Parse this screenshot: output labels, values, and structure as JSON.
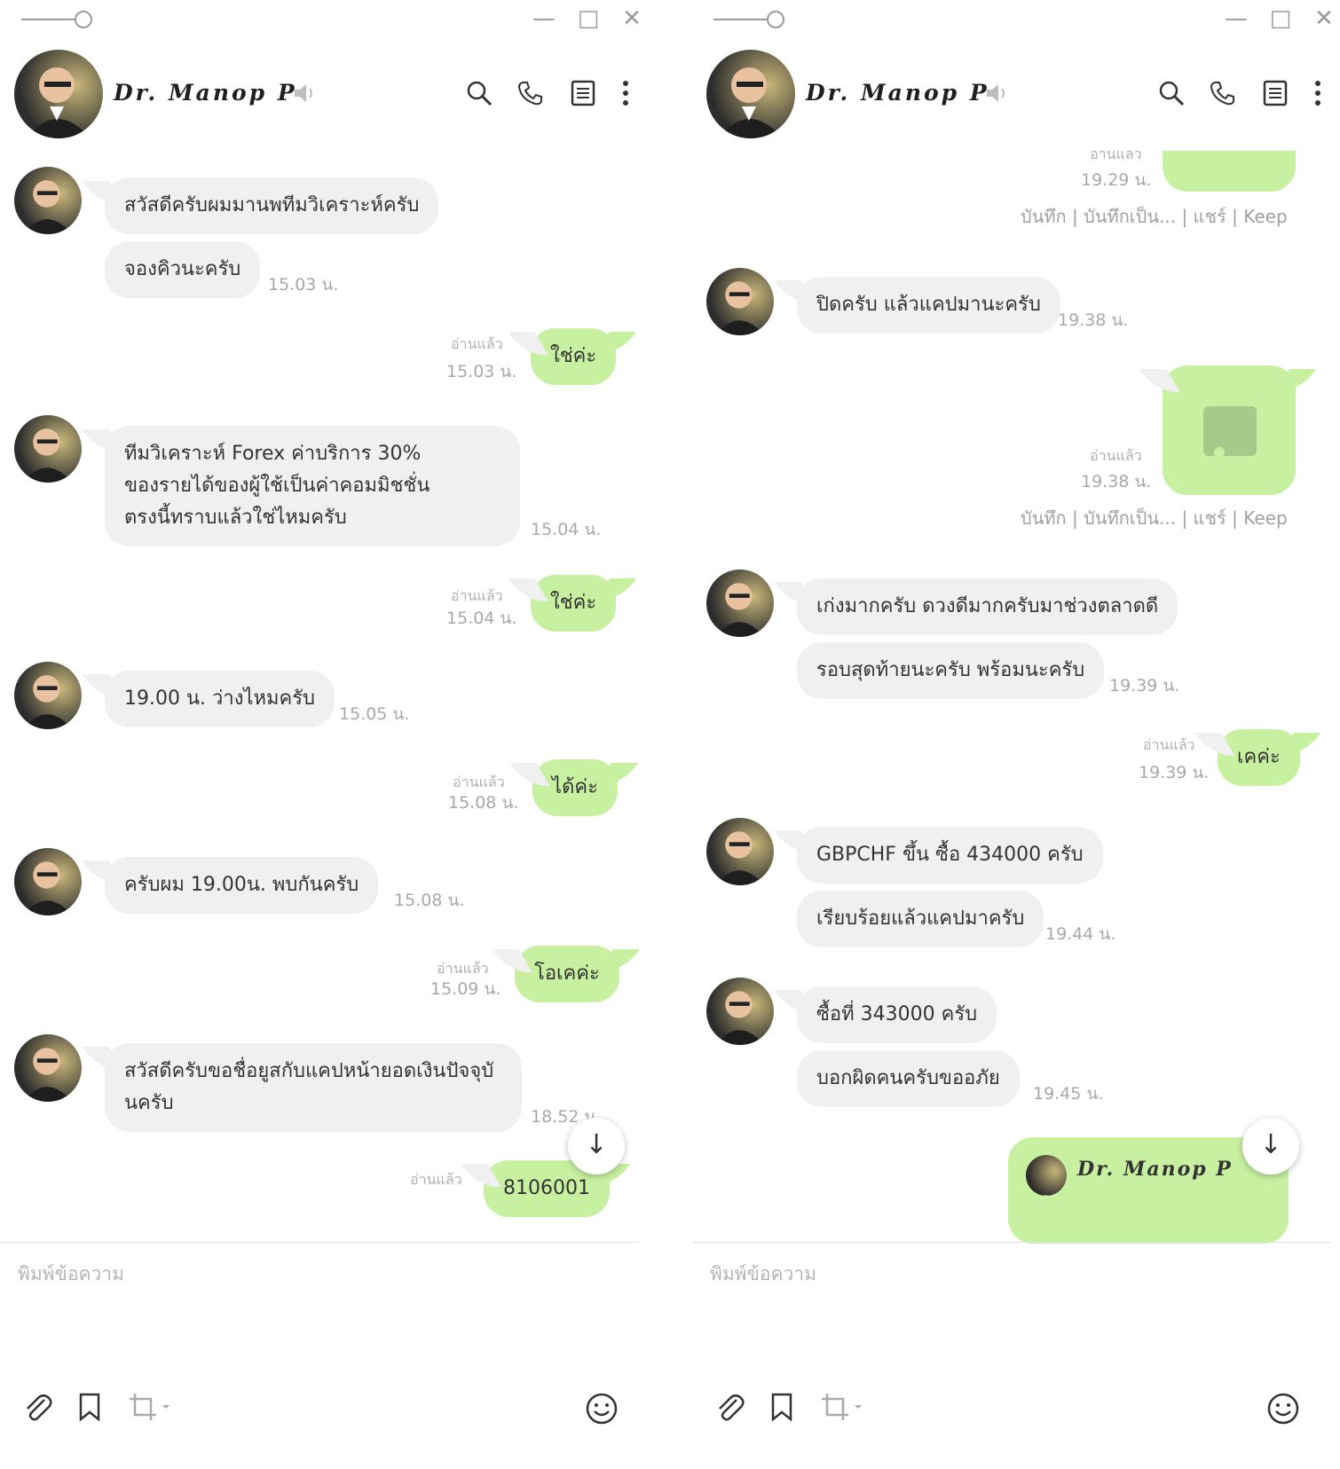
{
  "contact_name": "Dr. Manop P",
  "input_placeholder": "พิมพ์ข้อความ",
  "read_label": "อ่านแล้ว",
  "left": {
    "messages": [
      {
        "text": "สวัสดีครับผมมานพทีมวิเคราะห์ครับ"
      },
      {
        "text": "จองคิวนะครับ",
        "time": "15.03 น."
      },
      {
        "text": "ใช่ค่ะ",
        "time": "15.03 น."
      },
      {
        "text": "ทีมวิเคราะห์ Forex  ค่าบริการ 30%\nของรายได้ของผู้ใช้เป็นค่าคอมมิชชั่น\nตรงนี้ทราบแล้วใช่ไหมครับ",
        "time": "15.04 น."
      },
      {
        "text": "ใช่ค่ะ",
        "time": "15.04 น."
      },
      {
        "text": "19.00 น. ว่างไหมครับ",
        "time": "15.05 น."
      },
      {
        "text": "ได้ค่ะ",
        "time": "15.08 น."
      },
      {
        "text": "ครับผม 19.00น. พบกันครับ",
        "time": "15.08 น."
      },
      {
        "text": "โอเคค่ะ",
        "time": "15.09 น."
      },
      {
        "text": "สวัสดีครับขอชื่อยูสกับแคปหน้ายอดเงินปัจจุบั\nนครับ",
        "time": "18.52 น."
      },
      {
        "text": "8106001"
      }
    ]
  },
  "right": {
    "partial_read": "อ่านแล้ว",
    "messages": [
      {
        "time": "19.29 น."
      },
      {
        "text": "ปิดครับ แล้วแคปมานะครับ",
        "time": "19.38 น."
      },
      {
        "time": "19.38 น."
      },
      {
        "text": "เก่งมากครับ ดวงดีมากครับมาช่วงตลาดดี"
      },
      {
        "text": "รอบสุดท้ายนะครับ พร้อมนะครับ",
        "time": "19.39 น."
      },
      {
        "text": "เคค่ะ",
        "time": "19.39 น."
      },
      {
        "text": "GBPCHF ขึ้น ซื้อ 434000 ครับ"
      },
      {
        "text": "เรียบร้อยแล้วแคปมาครับ",
        "time": "19.44 น."
      },
      {
        "text": "ซื้อที่ 343000 ครับ"
      },
      {
        "text": "บอกผิดคนครับขออภัย",
        "time": "19.45 น."
      },
      {
        "text": "Dr. Manop P"
      }
    ],
    "actions": {
      "save": "บันทึก",
      "save_as": "บันทึกเป็น...",
      "share": "แชร์",
      "keep": "Keep",
      "sep": "|"
    }
  },
  "colors": {
    "my_bubble": "#c7f0a0",
    "their_bubble": "#f0f0f0",
    "muted_text": "#a8a8a8"
  },
  "icons": [
    "mute-icon",
    "search-icon",
    "phone-icon",
    "notes-icon",
    "more-icon",
    "paperclip-icon",
    "bookmark-icon",
    "crop-icon",
    "emoji-icon",
    "arrow-down-icon",
    "image-icon"
  ]
}
